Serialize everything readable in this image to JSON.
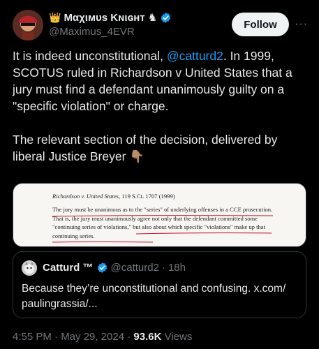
{
  "author": {
    "display_name": "Mαχιмυѕ Kɴιɢʜᴛ",
    "name_emoji": "👑",
    "name_suffix": "♞",
    "handle": "@Maximus_4EVR",
    "verified": true
  },
  "actions": {
    "follow_label": "Follow",
    "more_label": "···"
  },
  "tweet": {
    "para1_before": "It is indeed unconstitutional, ",
    "para1_mention": "@catturd2",
    "para1_after": ". In 1999, SCOTUS ruled in Richardson v  United States that a jury must find a defendant unanimously guilty on a \"specific violation\" or charge.",
    "para2": "The relevant section of the decision, delivered by liberal Justice Breyer",
    "para2_emoji": "👇🏽"
  },
  "document": {
    "citation_case": "Richardson v. United States",
    "citation_rest": ", 119 S.Ct. 1707 (1999)",
    "body": "The jury must be unanimous as to the \"series\" of underlying offenses in a CCE prosecution. That is, the jury must unanimously agree not only that the defendant committed some \"continuing series of violations,\" but also about which specific \"violations\" make up that continuing series."
  },
  "quoted_tweet": {
    "display_name": "Catturd ™",
    "handle": "@catturd2",
    "separator": "·",
    "time": "18h",
    "text": "Because they’re unconstitutional and confusing. x.com/ paulingrassia/..."
  },
  "meta": {
    "time": "4:55 PM · May 29, 2024 · ",
    "views_count": "93.6K",
    "views_label": " Views"
  },
  "colors": {
    "background": "#000000",
    "text": "#e7e9ea",
    "secondary": "#71767b",
    "link": "#1d9bf0",
    "underline_red": "#c8102e"
  }
}
